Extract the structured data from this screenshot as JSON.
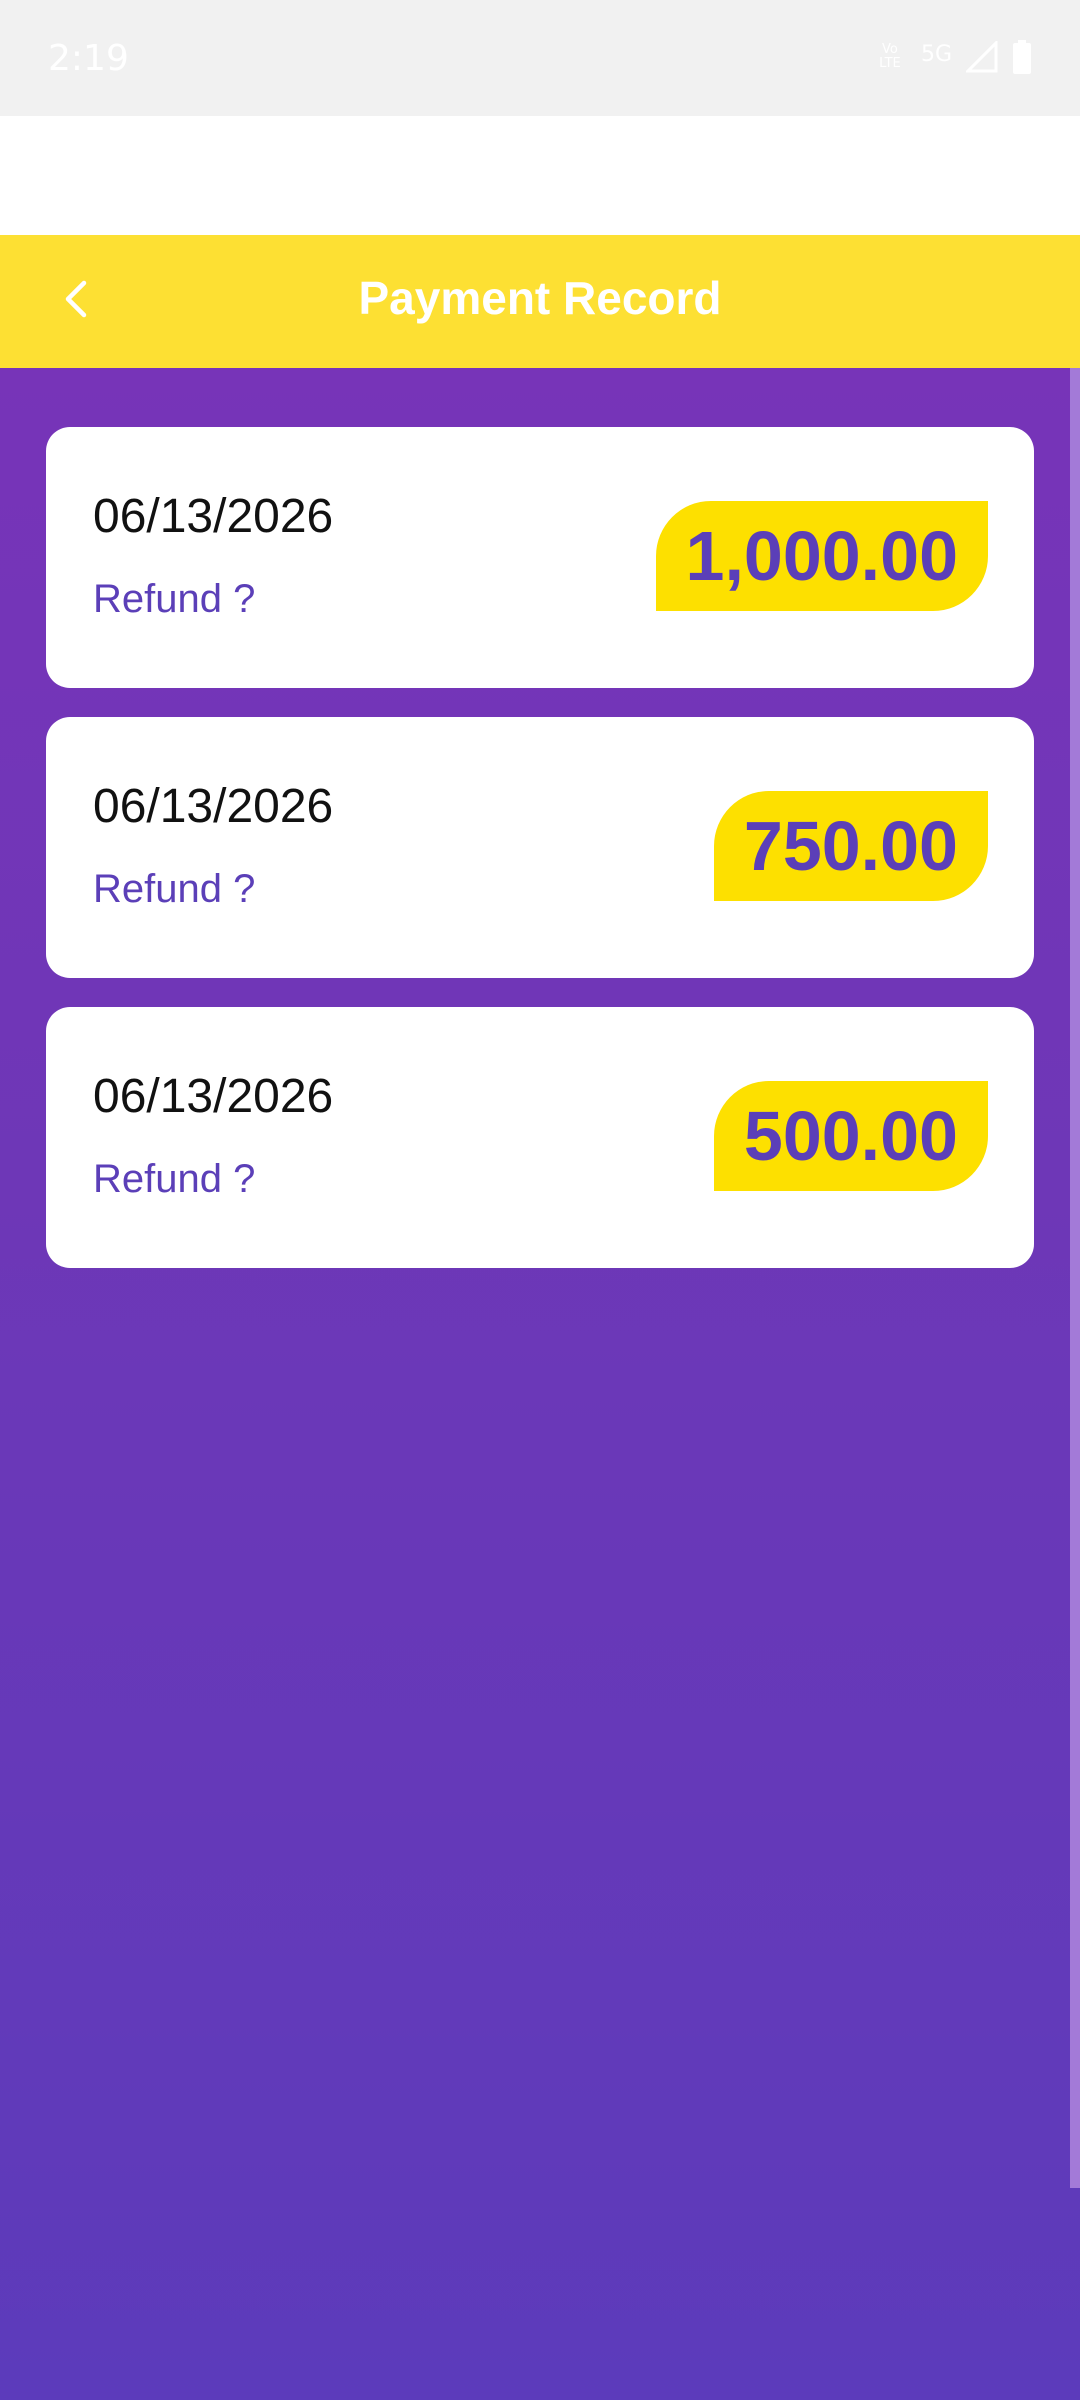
{
  "status_bar": {
    "time": "2:19",
    "network_volte": "VoLTE",
    "network_type": "5G",
    "icons": [
      "volte-icon",
      "signal-icon",
      "battery-icon"
    ]
  },
  "header": {
    "title": "Payment Record",
    "back_icon": "chevron-left-icon"
  },
  "records": [
    {
      "date": "06/13/2026",
      "refund_label": "Refund ?",
      "amount": "1,000.00"
    },
    {
      "date": "06/13/2026",
      "refund_label": "Refund ?",
      "amount": "750.00"
    },
    {
      "date": "06/13/2026",
      "refund_label": "Refund ?",
      "amount": "500.00"
    }
  ],
  "colors": {
    "header_bg": "#fde033",
    "badge_bg": "#fde000",
    "accent_purple": "#5b3fb8",
    "content_bg_top": "#7734b8",
    "content_bg_bottom": "#5c3bbb"
  }
}
